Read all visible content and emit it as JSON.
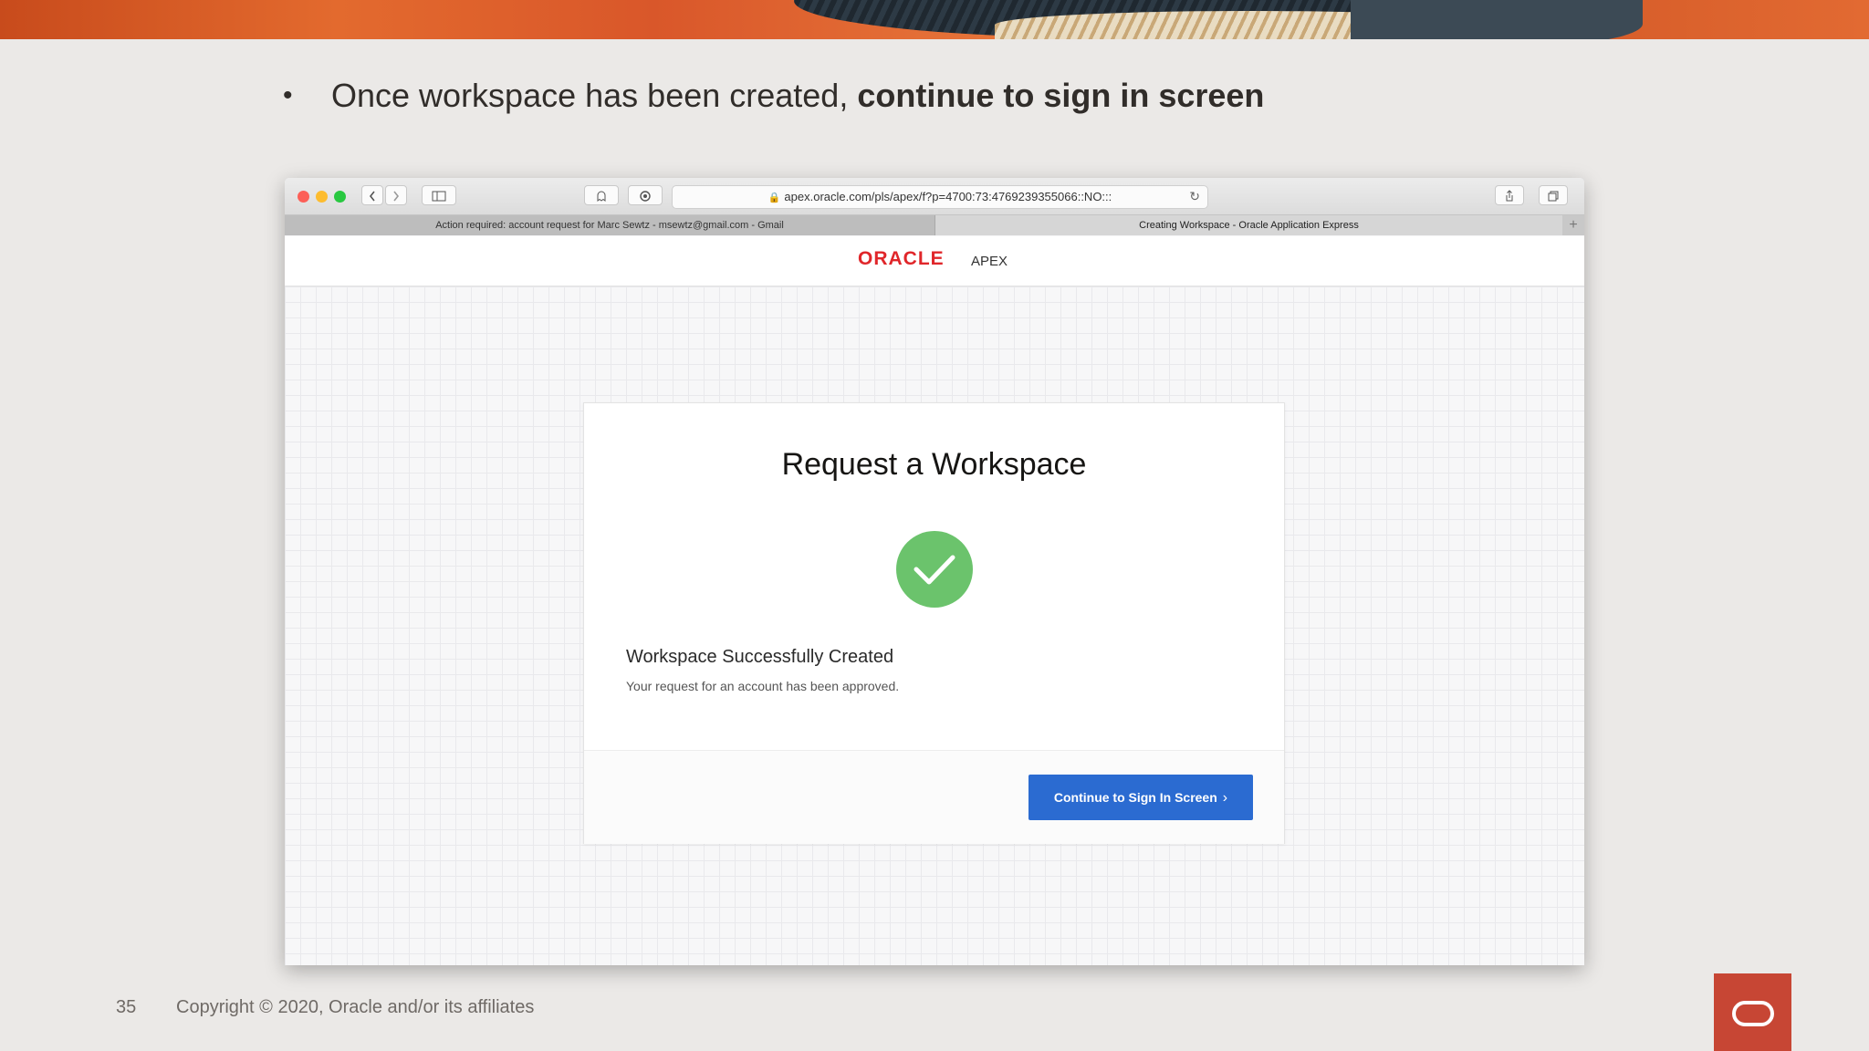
{
  "slide": {
    "bullet_regular": "Once workspace has been created,",
    "bullet_bold": "continue to sign in screen",
    "page_number": "35",
    "copyright": "Copyright © 2020, Oracle and/or its affiliates"
  },
  "browser": {
    "url": "apex.oracle.com/pls/apex/f?p=4700:73:4769239355066::NO:::",
    "tabs": [
      {
        "label": "Action required: account request for Marc Sewtz - msewtz@gmail.com - Gmail"
      },
      {
        "label": "Creating Workspace - Oracle Application Express"
      }
    ]
  },
  "apex": {
    "brand": "ORACLE",
    "product": "APEX",
    "card_title": "Request a Workspace",
    "status_title": "Workspace Successfully Created",
    "status_message": "Your request for an account has been approved.",
    "continue_label": "Continue to Sign In Screen"
  },
  "colors": {
    "success": "#6bc36c",
    "primary_button": "#2b6bd1",
    "oracle_red": "#c74634"
  }
}
